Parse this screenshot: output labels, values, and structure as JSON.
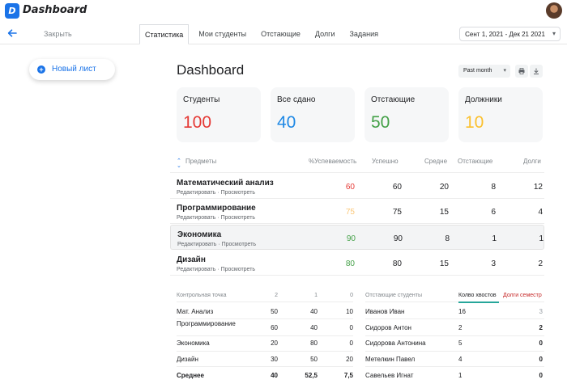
{
  "app": {
    "logo_letter": "D",
    "title": "Dashboard"
  },
  "nav": {
    "close_label": "Закрыть",
    "tabs": [
      {
        "label": "Статистика",
        "active": true
      },
      {
        "label": "Мои студенты",
        "active": false
      },
      {
        "label": "Отстающие",
        "active": false
      },
      {
        "label": "Долги",
        "active": false
      },
      {
        "label": "Задания",
        "active": false
      }
    ],
    "date_range": "Сент 1, 2021 - Дек 21 2021"
  },
  "new_sheet_label": "Новый лист",
  "page_title": "Dashboard",
  "period": "Past month",
  "cards": [
    {
      "label": "Студенты",
      "value": "100",
      "color": "#e53935"
    },
    {
      "label": "Все сдано",
      "value": "40",
      "color": "#1e88e5"
    },
    {
      "label": "Отстающие",
      "value": "50",
      "color": "#43a047"
    },
    {
      "label": "Должники",
      "value": "10",
      "color": "#fbc02d"
    }
  ],
  "subjects": {
    "headers": [
      "Предметы",
      "%Успеваемость",
      "Успешно",
      "Средне",
      "Отстающие",
      "Долги"
    ],
    "actions": "Редактировать · Просмотреть",
    "rows": [
      {
        "name": "Математический анализ",
        "percent": "60",
        "percent_color": "#e53935",
        "success": "60",
        "average": "20",
        "behind": "8",
        "debts": "12"
      },
      {
        "name": "Программирование",
        "percent": "75",
        "percent_color": "#fbc879",
        "success": "75",
        "average": "15",
        "behind": "6",
        "debts": "4"
      },
      {
        "name": "Экономика",
        "percent": "90",
        "percent_color": "#43a047",
        "success": "90",
        "average": "8",
        "behind": "1",
        "debts": "1"
      },
      {
        "name": "Дизайн",
        "percent": "80",
        "percent_color": "#43a047",
        "success": "80",
        "average": "15",
        "behind": "3",
        "debts": "2"
      }
    ]
  },
  "checkpoints": {
    "headers": [
      "Контрольная точка",
      "2",
      "1",
      "0"
    ],
    "rows": [
      {
        "name": "Мат. Анализ",
        "c2": "50",
        "c1": "40",
        "c0": "10"
      },
      {
        "name": "Программирование",
        "c2": "60",
        "c1": "40",
        "c0": "0"
      },
      {
        "name": "Экономика",
        "c2": "20",
        "c1": "80",
        "c0": "0"
      },
      {
        "name": "Дизайн",
        "c2": "30",
        "c1": "50",
        "c0": "20"
      }
    ],
    "footer": {
      "name": "Среднее",
      "c2": "40",
      "c1": "52,5",
      "c0": "7,5"
    }
  },
  "lagging": {
    "headers": [
      "Отстающие студенты",
      "Колво хвостов",
      "Долги семестр"
    ],
    "rows": [
      {
        "name": "Иванов Иван",
        "tails": "16",
        "debts": "3"
      },
      {
        "name": "Сидоров Антон",
        "tails": "2",
        "debts": "2"
      },
      {
        "name": "Сидорова Антонина",
        "tails": "5",
        "debts": "0"
      },
      {
        "name": "Метелкин Павел",
        "tails": "4",
        "debts": "0"
      },
      {
        "name": "Савельев Игнат",
        "tails": "1",
        "debts": "0"
      }
    ]
  }
}
